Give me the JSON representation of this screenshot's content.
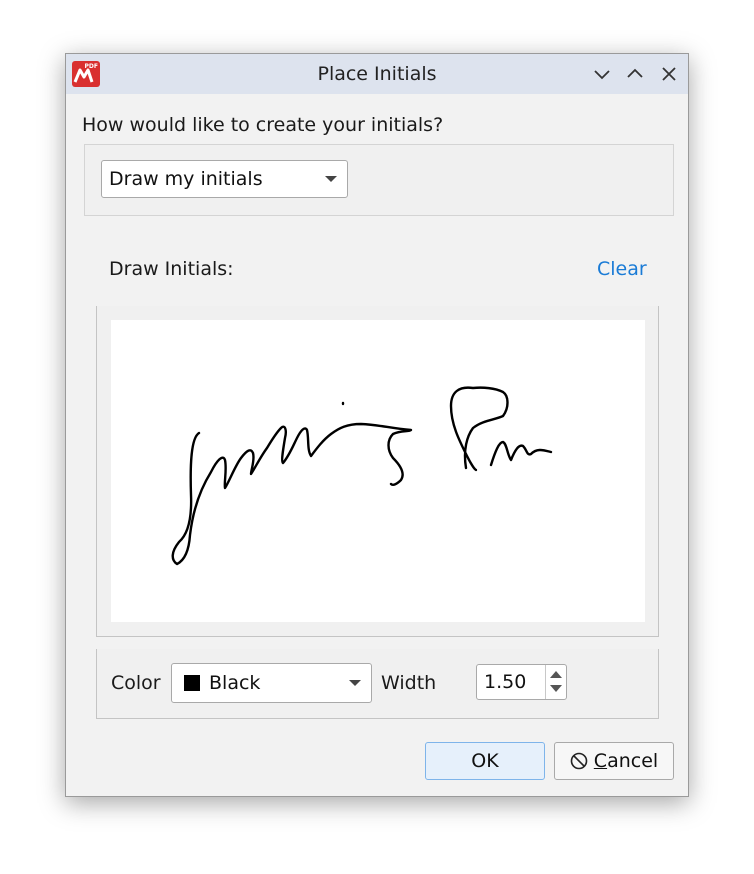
{
  "window": {
    "title": "Place Initials",
    "controls": [
      "chevron-down-icon",
      "chevron-up-icon",
      "close-icon"
    ]
  },
  "app_logo": {
    "badge": "PDF",
    "icon": "pdf-app-logo-icon",
    "color": "#d93030"
  },
  "method": {
    "question": "How would like to create your initials?",
    "selected": "Draw my initials"
  },
  "draw": {
    "label": "Draw Initials:",
    "clear_label": "Clear"
  },
  "options": {
    "color_label": "Color",
    "color_value": "Black",
    "color_swatch": "#000000",
    "width_label": "Width",
    "width_value": "1.50"
  },
  "buttons": {
    "ok_label": "OK",
    "cancel_first": "C",
    "cancel_rest": "ancel"
  },
  "colors": {
    "accent": "#1a7bd6",
    "titlebar": "#dde3ee"
  }
}
